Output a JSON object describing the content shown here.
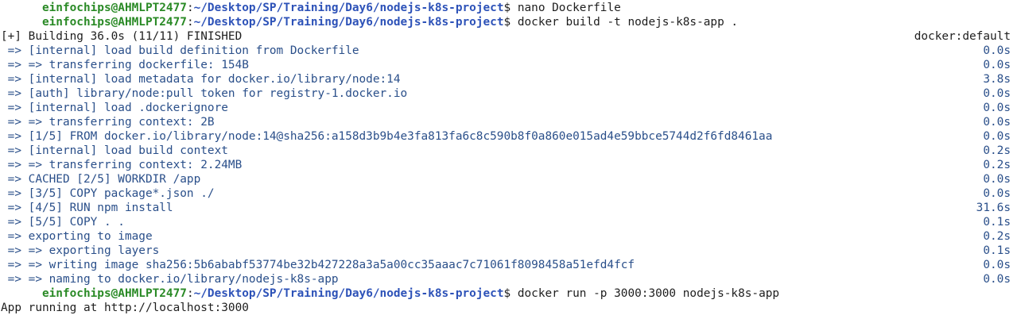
{
  "prompt": {
    "user": "einfochips@AHMLPT2477",
    "sep": ":",
    "path": "~/Desktop/SP/Training/Day6/nodejs-k8s-project",
    "sigil": "$ "
  },
  "commands": {
    "nano": "nano Dockerfile",
    "build": "docker build -t nodejs-k8s-app .",
    "run": "docker run -p 3000:3000 nodejs-k8s-app"
  },
  "build_header": {
    "text": "[+] Building 36.0s (11/11) FINISHED",
    "builder": "docker:default"
  },
  "build_steps": [
    {
      "text": " => [internal] load build definition from Dockerfile",
      "time": "0.0s"
    },
    {
      "text": " => => transferring dockerfile: 154B",
      "time": "0.0s"
    },
    {
      "text": " => [internal] load metadata for docker.io/library/node:14",
      "time": "3.8s"
    },
    {
      "text": " => [auth] library/node:pull token for registry-1.docker.io",
      "time": "0.0s"
    },
    {
      "text": " => [internal] load .dockerignore",
      "time": "0.0s"
    },
    {
      "text": " => => transferring context: 2B",
      "time": "0.0s"
    },
    {
      "text": " => [1/5] FROM docker.io/library/node:14@sha256:a158d3b9b4e3fa813fa6c8c590b8f0a860e015ad4e59bbce5744d2f6fd8461aa",
      "time": "0.0s"
    },
    {
      "text": " => [internal] load build context",
      "time": "0.2s"
    },
    {
      "text": " => => transferring context: 2.24MB",
      "time": "0.2s"
    },
    {
      "text": " => CACHED [2/5] WORKDIR /app",
      "time": "0.0s"
    },
    {
      "text": " => [3/5] COPY package*.json ./",
      "time": "0.0s"
    },
    {
      "text": " => [4/5] RUN npm install",
      "time": "31.6s"
    },
    {
      "text": " => [5/5] COPY . .",
      "time": "0.1s"
    },
    {
      "text": " => exporting to image",
      "time": "0.2s"
    },
    {
      "text": " => => exporting layers",
      "time": "0.1s"
    },
    {
      "text": " => => writing image sha256:5b6ababf53774be32b427228a3a5a00cc35aaac7c71061f8098458a51efd4fcf",
      "time": "0.0s"
    },
    {
      "text": " => => naming to docker.io/library/nodejs-k8s-app",
      "time": "0.0s"
    }
  ],
  "app_output": "App running at http://localhost:3000",
  "colors": {
    "prompt_user": "#2a8a26",
    "prompt_path": "#2d52b8",
    "step_text": "#2a4f8a",
    "background": "#ffffff"
  }
}
